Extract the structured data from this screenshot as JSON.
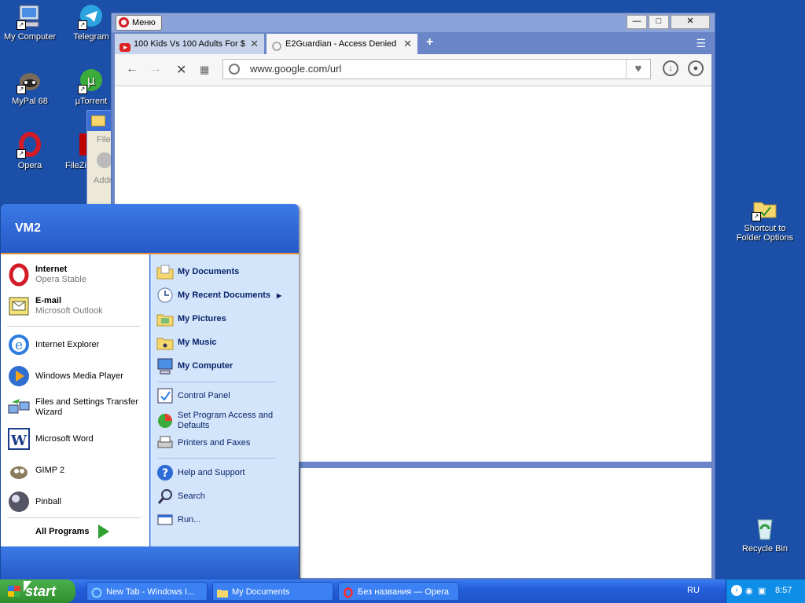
{
  "desktop": {
    "icons": [
      {
        "label": "My Computer",
        "icon": "my-computer-icon"
      },
      {
        "label": "Telegram",
        "icon": "telegram-icon"
      },
      {
        "label": "MyPal 68",
        "icon": "mypal-icon"
      },
      {
        "label": "µTorrent",
        "icon": "utorrent-icon"
      },
      {
        "label": "Opera",
        "icon": "opera-icon"
      },
      {
        "label": "FileZi",
        "icon": "filezilla-icon"
      },
      {
        "label": "Shortcut to Folder Options",
        "icon": "folder-options-icon"
      },
      {
        "label": "Recycle Bin",
        "icon": "recycle-bin-icon"
      }
    ]
  },
  "explorer_fragment": {
    "menu_label": "File",
    "address_label": "Addr"
  },
  "browser": {
    "menu_label": "Меню",
    "tabs": [
      {
        "label": "100 Kids Vs 100 Adults For $",
        "icon": "youtube-icon"
      },
      {
        "label": "E2Guardian - Access Denied",
        "icon": "loading-icon"
      }
    ],
    "url": "www.google.com/url",
    "window_buttons": {
      "minimize": "—",
      "maximize": "□",
      "close": "✕"
    }
  },
  "start_menu": {
    "user": "VM2",
    "pinned": [
      {
        "main": "Internet",
        "sub": "Opera Stable",
        "icon": "opera-icon"
      },
      {
        "main": "E-mail",
        "sub": "Microsoft Outlook",
        "icon": "outlook-icon"
      }
    ],
    "recent": [
      {
        "label": "Internet Explorer",
        "icon": "ie-icon"
      },
      {
        "label": "Windows Media Player",
        "icon": "media-player-icon"
      },
      {
        "label": "Files and Settings Transfer Wizard",
        "icon": "transfer-wizard-icon"
      },
      {
        "label": "Microsoft Word",
        "icon": "word-icon"
      },
      {
        "label": "GIMP 2",
        "icon": "gimp-icon"
      },
      {
        "label": "Pinball",
        "icon": "pinball-icon"
      }
    ],
    "all_programs": "All Programs",
    "places": [
      {
        "label": "My Documents",
        "icon": "documents-icon"
      },
      {
        "label": "My Recent Documents",
        "icon": "recent-documents-icon"
      },
      {
        "label": "My Pictures",
        "icon": "pictures-icon"
      },
      {
        "label": "My Music",
        "icon": "music-icon"
      },
      {
        "label": "My Computer",
        "icon": "my-computer-icon"
      }
    ],
    "system": [
      {
        "label": "Control Panel",
        "icon": "control-panel-icon"
      },
      {
        "label": "Set Program Access and Defaults",
        "icon": "program-defaults-icon"
      },
      {
        "label": "Printers and Faxes",
        "icon": "printer-icon"
      }
    ],
    "help": [
      {
        "label": "Help and Support",
        "icon": "help-icon"
      },
      {
        "label": "Search",
        "icon": "search-icon"
      },
      {
        "label": "Run...",
        "icon": "run-icon"
      }
    ]
  },
  "taskbar": {
    "start_label": "start",
    "buttons": [
      {
        "label": "New Tab - Windows I...",
        "icon": "ie-icon"
      },
      {
        "label": "My Documents",
        "icon": "folder-icon"
      },
      {
        "label": "Без названия — Opera",
        "icon": "opera-icon"
      }
    ],
    "language": "RU",
    "clock": "8:57"
  },
  "colors": {
    "xp_blue": "#245edb",
    "start_green": "#3a9c3a",
    "opera_red": "#d31b27"
  }
}
